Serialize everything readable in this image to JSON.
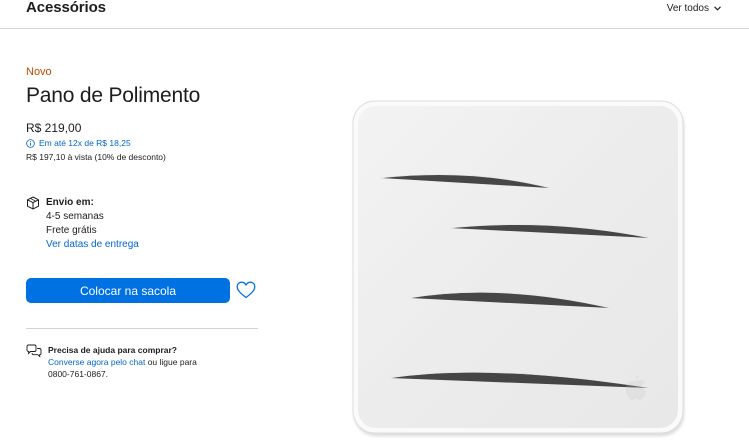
{
  "header": {
    "section_title": "Acessórios",
    "see_all": "Ver todos"
  },
  "product": {
    "badge": "Novo",
    "title": "Pano de Polimento",
    "price": "R$ 219,00",
    "installments": "Em até 12x de R$ 18,25",
    "cash_price": "R$ 197,10 à vista (10% de desconto)"
  },
  "shipping": {
    "title": "Envio em:",
    "lead_time": "4-5 semanas",
    "shipping_cost": "Frete grátis",
    "dates_link": "Ver datas de entrega"
  },
  "actions": {
    "add_to_bag": "Colocar na sacola"
  },
  "help": {
    "title": "Precisa de ajuda para comprar?",
    "chat_link": "Converse agora pelo chat",
    "or_call": " ou ligue para",
    "phone": "0800-761-0867."
  },
  "colors": {
    "accent_blue": "#0071e3",
    "link_blue": "#0066cc",
    "badge_orange": "#bf4800"
  },
  "icons": {
    "chevron": "chevron-down-icon",
    "info": "info-icon",
    "shipping": "box-icon",
    "favorite": "heart-icon",
    "chat": "chat-bubbles-icon"
  }
}
